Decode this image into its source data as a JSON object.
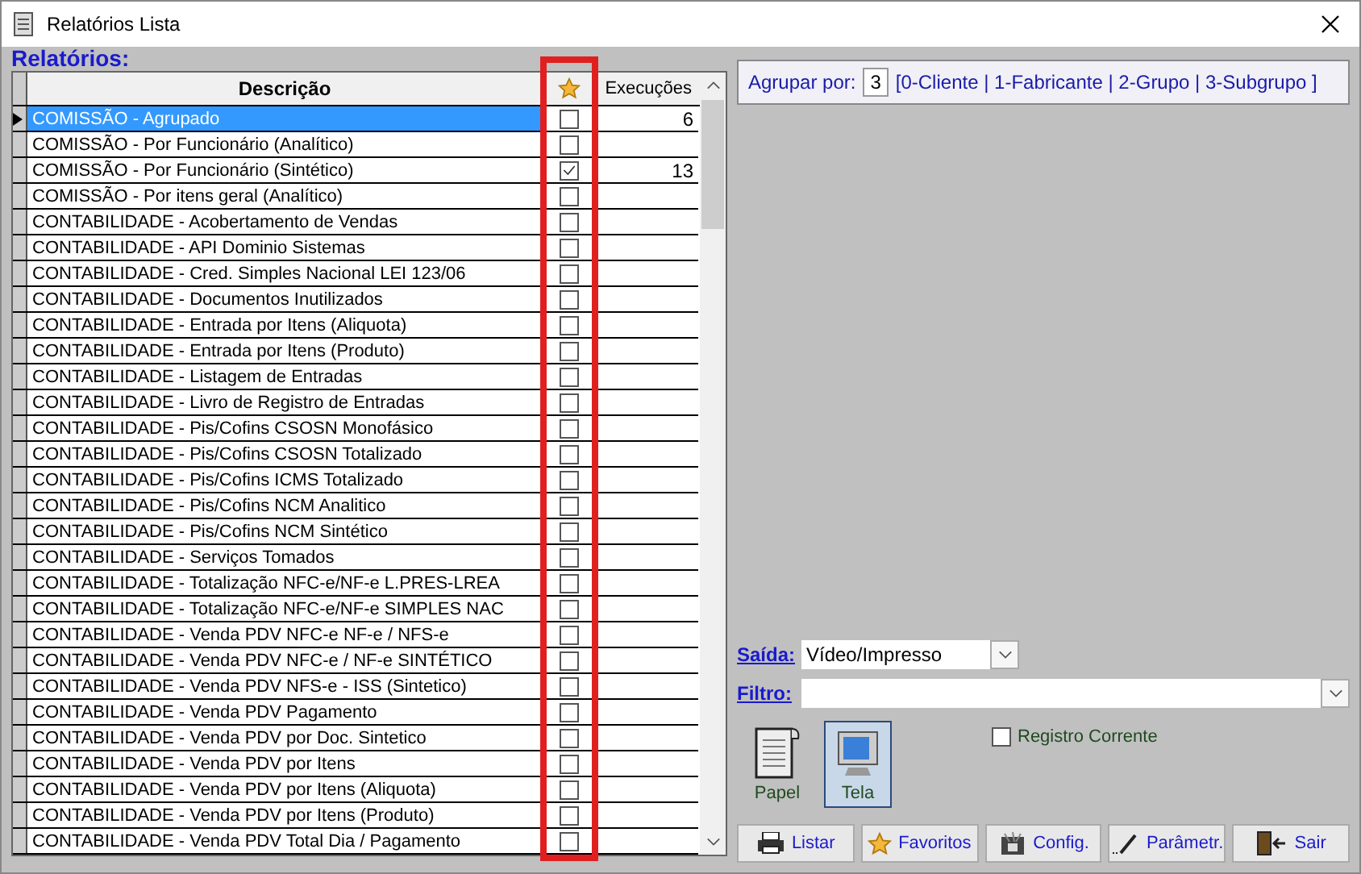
{
  "window": {
    "title": "Relatórios Lista"
  },
  "section_label": "Relatórios:",
  "table": {
    "columns": [
      "Descrição",
      "Execuções"
    ],
    "rows": [
      {
        "description": "COMISSÃO - Agrupado",
        "favorite": false,
        "count": "6",
        "selected": true
      },
      {
        "description": "COMISSÃO - Por Funcionário (Analítico)",
        "favorite": false,
        "selected": false
      },
      {
        "description": "COMISSÃO - Por Funcionário (Sintético)",
        "favorite": true,
        "count": "13",
        "selected": false
      },
      {
        "description": "COMISSÃO - Por itens geral (Analítico)",
        "favorite": false,
        "selected": false
      },
      {
        "description": "CONTABILIDADE - Acobertamento de Vendas",
        "favorite": false,
        "selected": false
      },
      {
        "description": "CONTABILIDADE - API Dominio Sistemas",
        "favorite": false,
        "selected": false
      },
      {
        "description": "CONTABILIDADE - Cred. Simples Nacional LEI 123/06",
        "favorite": false,
        "selected": false
      },
      {
        "description": "CONTABILIDADE - Documentos Inutilizados",
        "favorite": false,
        "selected": false
      },
      {
        "description": "CONTABILIDADE - Entrada por Itens (Aliquota)",
        "favorite": false,
        "selected": false
      },
      {
        "description": "CONTABILIDADE - Entrada por Itens (Produto)",
        "favorite": false,
        "selected": false
      },
      {
        "description": "CONTABILIDADE - Listagem de Entradas",
        "favorite": false,
        "selected": false
      },
      {
        "description": "CONTABILIDADE - Livro de Registro de Entradas",
        "favorite": false,
        "selected": false
      },
      {
        "description": "CONTABILIDADE - Pis/Cofins CSOSN Monofásico",
        "favorite": false,
        "selected": false
      },
      {
        "description": "CONTABILIDADE - Pis/Cofins CSOSN Totalizado",
        "favorite": false,
        "selected": false
      },
      {
        "description": "CONTABILIDADE - Pis/Cofins ICMS Totalizado",
        "favorite": false,
        "selected": false
      },
      {
        "description": "CONTABILIDADE - Pis/Cofins NCM Analitico",
        "favorite": false,
        "selected": false
      },
      {
        "description": "CONTABILIDADE - Pis/Cofins NCM Sintético",
        "favorite": false,
        "selected": false
      },
      {
        "description": "CONTABILIDADE - Serviços Tomados",
        "favorite": false,
        "selected": false
      },
      {
        "description": "CONTABILIDADE - Totalização NFC-e/NF-e L.PRES-LREA",
        "favorite": false,
        "selected": false
      },
      {
        "description": "CONTABILIDADE - Totalização NFC-e/NF-e SIMPLES NAC",
        "favorite": false,
        "selected": false
      },
      {
        "description": "CONTABILIDADE - Venda PDV NFC-e  NF-e / NFS-e",
        "favorite": false,
        "selected": false
      },
      {
        "description": "CONTABILIDADE - Venda PDV NFC-e / NF-e SINTÉTICO",
        "favorite": false,
        "selected": false
      },
      {
        "description": "CONTABILIDADE - Venda PDV NFS-e - ISS (Sintetico)",
        "favorite": false,
        "selected": false
      },
      {
        "description": "CONTABILIDADE - Venda PDV Pagamento",
        "favorite": false,
        "selected": false
      },
      {
        "description": "CONTABILIDADE - Venda PDV por Doc. Sintetico",
        "favorite": false,
        "selected": false
      },
      {
        "description": "CONTABILIDADE - Venda PDV por Itens",
        "favorite": false,
        "selected": false
      },
      {
        "description": "CONTABILIDADE - Venda PDV por Itens (Aliquota)",
        "favorite": false,
        "selected": false
      },
      {
        "description": "CONTABILIDADE - Venda PDV por Itens (Produto)",
        "favorite": false,
        "selected": false
      },
      {
        "description": "CONTABILIDADE - Venda PDV Total Dia / Pagamento",
        "favorite": false,
        "selected": false
      }
    ]
  },
  "group_by": {
    "label": "Agrupar por:",
    "value": "3",
    "options": "[0-Cliente | 1-Fabricante | 2-Grupo  | 3-Subgrupo ]"
  },
  "output": {
    "label": "Saída:",
    "value": "Vídeo/Impresso"
  },
  "filter": {
    "label": "Filtro:"
  },
  "modes": [
    {
      "label": "Papel",
      "kind": "paper",
      "selected": false
    },
    {
      "label": "Tela",
      "kind": "screen",
      "selected": true
    }
  ],
  "current_record": {
    "label": "Registro Corrente",
    "checked": false
  },
  "buttons": [
    {
      "label": "Listar",
      "kind": "print"
    },
    {
      "label": "Favoritos",
      "kind": "star"
    },
    {
      "label": "Config.",
      "kind": "config"
    },
    {
      "label": "Parâmetr.",
      "kind": "pencil"
    },
    {
      "label": "Sair",
      "kind": "exit"
    }
  ]
}
